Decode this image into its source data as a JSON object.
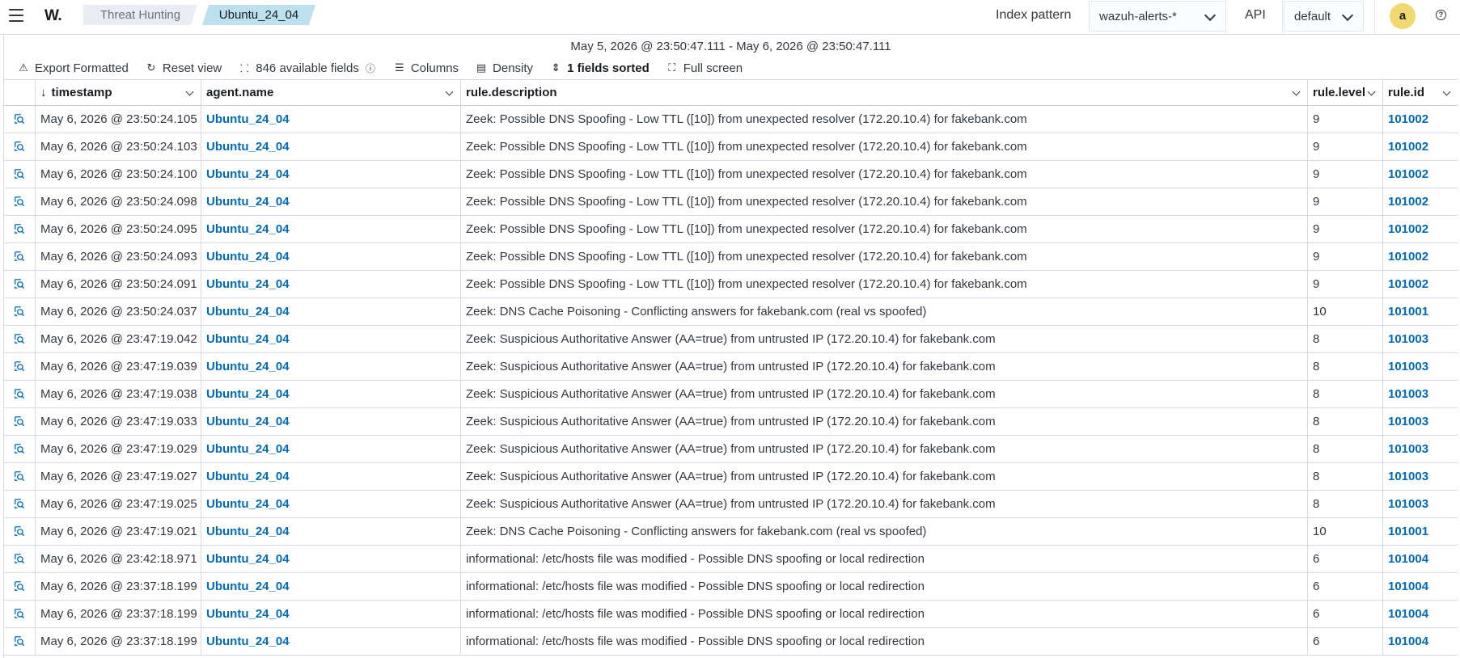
{
  "header": {
    "logo": "W.",
    "breadcrumbs": [
      "Threat Hunting",
      "Ubuntu_24_04"
    ],
    "index_pattern_label": "Index pattern",
    "index_pattern_value": "wazuh-alerts-*",
    "api_label": "API",
    "api_value": "default",
    "avatar_letter": "a",
    "help_glyph": "?"
  },
  "panel": {
    "date_range": "May 5, 2026 @ 23:50:47.111 - May 6, 2026 @ 23:50:47.111",
    "toolbar": {
      "export": "Export Formatted",
      "reset": "Reset view",
      "fields": "846 available fields",
      "columns": "Columns",
      "density": "Density",
      "sorted": "1 fields sorted",
      "fullscreen": "Full screen"
    }
  },
  "table": {
    "columns": [
      "timestamp",
      "agent.name",
      "rule.description",
      "rule.level",
      "rule.id"
    ],
    "sort_glyph": "↓",
    "rows": [
      {
        "timestamp": "May 6, 2026 @ 23:50:24.105",
        "agent": "Ubuntu_24_04",
        "description": "Zeek: Possible DNS Spoofing - Low TTL ([10]) from unexpected resolver (172.20.10.4) for fakebank.com",
        "level": "9",
        "id": "101002"
      },
      {
        "timestamp": "May 6, 2026 @ 23:50:24.103",
        "agent": "Ubuntu_24_04",
        "description": "Zeek: Possible DNS Spoofing - Low TTL ([10]) from unexpected resolver (172.20.10.4) for fakebank.com",
        "level": "9",
        "id": "101002"
      },
      {
        "timestamp": "May 6, 2026 @ 23:50:24.100",
        "agent": "Ubuntu_24_04",
        "description": "Zeek: Possible DNS Spoofing - Low TTL ([10]) from unexpected resolver (172.20.10.4) for fakebank.com",
        "level": "9",
        "id": "101002"
      },
      {
        "timestamp": "May 6, 2026 @ 23:50:24.098",
        "agent": "Ubuntu_24_04",
        "description": "Zeek: Possible DNS Spoofing - Low TTL ([10]) from unexpected resolver (172.20.10.4) for fakebank.com",
        "level": "9",
        "id": "101002"
      },
      {
        "timestamp": "May 6, 2026 @ 23:50:24.095",
        "agent": "Ubuntu_24_04",
        "description": "Zeek: Possible DNS Spoofing - Low TTL ([10]) from unexpected resolver (172.20.10.4) for fakebank.com",
        "level": "9",
        "id": "101002"
      },
      {
        "timestamp": "May 6, 2026 @ 23:50:24.093",
        "agent": "Ubuntu_24_04",
        "description": "Zeek: Possible DNS Spoofing - Low TTL ([10]) from unexpected resolver (172.20.10.4) for fakebank.com",
        "level": "9",
        "id": "101002"
      },
      {
        "timestamp": "May 6, 2026 @ 23:50:24.091",
        "agent": "Ubuntu_24_04",
        "description": "Zeek: Possible DNS Spoofing - Low TTL ([10]) from unexpected resolver (172.20.10.4) for fakebank.com",
        "level": "9",
        "id": "101002"
      },
      {
        "timestamp": "May 6, 2026 @ 23:50:24.037",
        "agent": "Ubuntu_24_04",
        "description": "Zeek: DNS Cache Poisoning - Conflicting answers for fakebank.com (real vs spoofed)",
        "level": "10",
        "id": "101001"
      },
      {
        "timestamp": "May 6, 2026 @ 23:47:19.042",
        "agent": "Ubuntu_24_04",
        "description": "Zeek: Suspicious Authoritative Answer (AA=true) from untrusted IP (172.20.10.4) for fakebank.com",
        "level": "8",
        "id": "101003"
      },
      {
        "timestamp": "May 6, 2026 @ 23:47:19.039",
        "agent": "Ubuntu_24_04",
        "description": "Zeek: Suspicious Authoritative Answer (AA=true) from untrusted IP (172.20.10.4) for fakebank.com",
        "level": "8",
        "id": "101003"
      },
      {
        "timestamp": "May 6, 2026 @ 23:47:19.038",
        "agent": "Ubuntu_24_04",
        "description": "Zeek: Suspicious Authoritative Answer (AA=true) from untrusted IP (172.20.10.4) for fakebank.com",
        "level": "8",
        "id": "101003"
      },
      {
        "timestamp": "May 6, 2026 @ 23:47:19.033",
        "agent": "Ubuntu_24_04",
        "description": "Zeek: Suspicious Authoritative Answer (AA=true) from untrusted IP (172.20.10.4) for fakebank.com",
        "level": "8",
        "id": "101003"
      },
      {
        "timestamp": "May 6, 2026 @ 23:47:19.029",
        "agent": "Ubuntu_24_04",
        "description": "Zeek: Suspicious Authoritative Answer (AA=true) from untrusted IP (172.20.10.4) for fakebank.com",
        "level": "8",
        "id": "101003"
      },
      {
        "timestamp": "May 6, 2026 @ 23:47:19.027",
        "agent": "Ubuntu_24_04",
        "description": "Zeek: Suspicious Authoritative Answer (AA=true) from untrusted IP (172.20.10.4) for fakebank.com",
        "level": "8",
        "id": "101003"
      },
      {
        "timestamp": "May 6, 2026 @ 23:47:19.025",
        "agent": "Ubuntu_24_04",
        "description": "Zeek: Suspicious Authoritative Answer (AA=true) from untrusted IP (172.20.10.4) for fakebank.com",
        "level": "8",
        "id": "101003"
      },
      {
        "timestamp": "May 6, 2026 @ 23:47:19.021",
        "agent": "Ubuntu_24_04",
        "description": "Zeek: DNS Cache Poisoning - Conflicting answers for fakebank.com (real vs spoofed)",
        "level": "10",
        "id": "101001"
      },
      {
        "timestamp": "May 6, 2026 @ 23:42:18.971",
        "agent": "Ubuntu_24_04",
        "description": "informational: /etc/hosts file was modified - Possible DNS spoofing or local redirection",
        "level": "6",
        "id": "101004"
      },
      {
        "timestamp": "May 6, 2026 @ 23:37:18.199",
        "agent": "Ubuntu_24_04",
        "description": "informational: /etc/hosts file was modified - Possible DNS spoofing or local redirection",
        "level": "6",
        "id": "101004"
      },
      {
        "timestamp": "May 6, 2026 @ 23:37:18.199",
        "agent": "Ubuntu_24_04",
        "description": "informational: /etc/hosts file was modified - Possible DNS spoofing or local redirection",
        "level": "6",
        "id": "101004"
      },
      {
        "timestamp": "May 6, 2026 @ 23:37:18.199",
        "agent": "Ubuntu_24_04",
        "description": "informational: /etc/hosts file was modified - Possible DNS spoofing or local redirection",
        "level": "6",
        "id": "101004"
      }
    ]
  },
  "colors": {
    "link": "#006bb8",
    "breadcrumb_active": "#bde0ee",
    "avatar": "#f1d86f"
  }
}
